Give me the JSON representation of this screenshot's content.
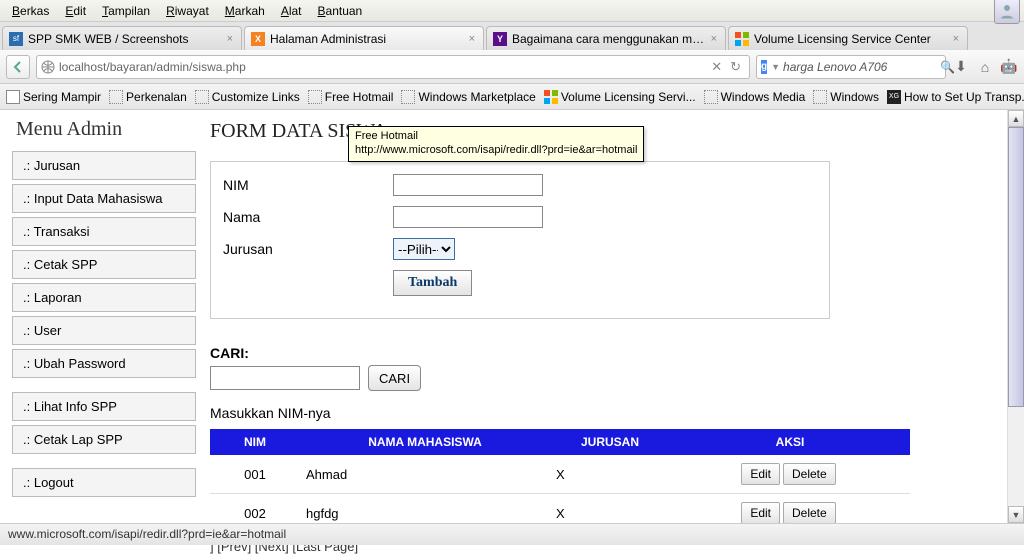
{
  "menu": {
    "items": [
      "Berkas",
      "Edit",
      "Tampilan",
      "Riwayat",
      "Markah",
      "Alat",
      "Bantuan"
    ]
  },
  "tabs": [
    {
      "title": "SPP SMK WEB / Screenshots",
      "fav": "sf",
      "favbg": "#2a6db0"
    },
    {
      "title": "Halaman Administrasi",
      "fav": "X",
      "favbg": "#f58220"
    },
    {
      "title": "Bagaimana cara menggunakan mesin cuci...",
      "fav": "Y",
      "favbg": "#5a0e8b"
    },
    {
      "title": "Volume Licensing Service Center",
      "fav": "⊞",
      "favbg": "#ffffff"
    }
  ],
  "nav": {
    "url": "localhost/bayaran/admin/siswa.php",
    "search_value": "harga Lenovo A706"
  },
  "bookmarks": [
    "Sering Mampir",
    "Perkenalan",
    "Customize Links",
    "Free Hotmail",
    "Windows Marketplace",
    "Volume Licensing Servi...",
    "Windows Media",
    "Windows",
    "How to Set Up Transp..."
  ],
  "tooltip": {
    "title": "Free Hotmail",
    "url": "http://www.microsoft.com/isapi/redir.dll?prd=ie&ar=hotmail"
  },
  "sidebar": {
    "title": "Menu Admin",
    "group1": [
      ".: Jurusan",
      ".: Input Data Mahasiswa",
      ".: Transaksi",
      ".: Cetak SPP",
      ".: Laporan",
      ".: User",
      ".: Ubah Password"
    ],
    "group2": [
      ".: Lihat Info SPP",
      ".: Cetak Lap SPP"
    ],
    "group3": [
      ".: Logout"
    ]
  },
  "page": {
    "title": "FORM DATA SISWA",
    "form": {
      "nim_label": "NIM",
      "nama_label": "Nama",
      "jurusan_label": "Jurusan",
      "jurusan_selected": "--Pilih--",
      "submit_label": "Tambah"
    },
    "cari": {
      "label": "CARI:",
      "button": "CARI",
      "hint": "Masukkan NIM-nya"
    },
    "table": {
      "headers": [
        "NIM",
        "NAMA MAHASISWA",
        "JURUSAN",
        "AKSI"
      ],
      "edit_label": "Edit",
      "delete_label": "Delete",
      "rows": [
        {
          "nim": "001",
          "nama": "Ahmad",
          "jurusan": "X"
        },
        {
          "nim": "002",
          "nama": "hgfdg",
          "jurusan": "X"
        }
      ]
    },
    "pager": "] [Prev] [Next] [Last Page]"
  },
  "status": "www.microsoft.com/isapi/redir.dll?prd=ie&ar=hotmail"
}
